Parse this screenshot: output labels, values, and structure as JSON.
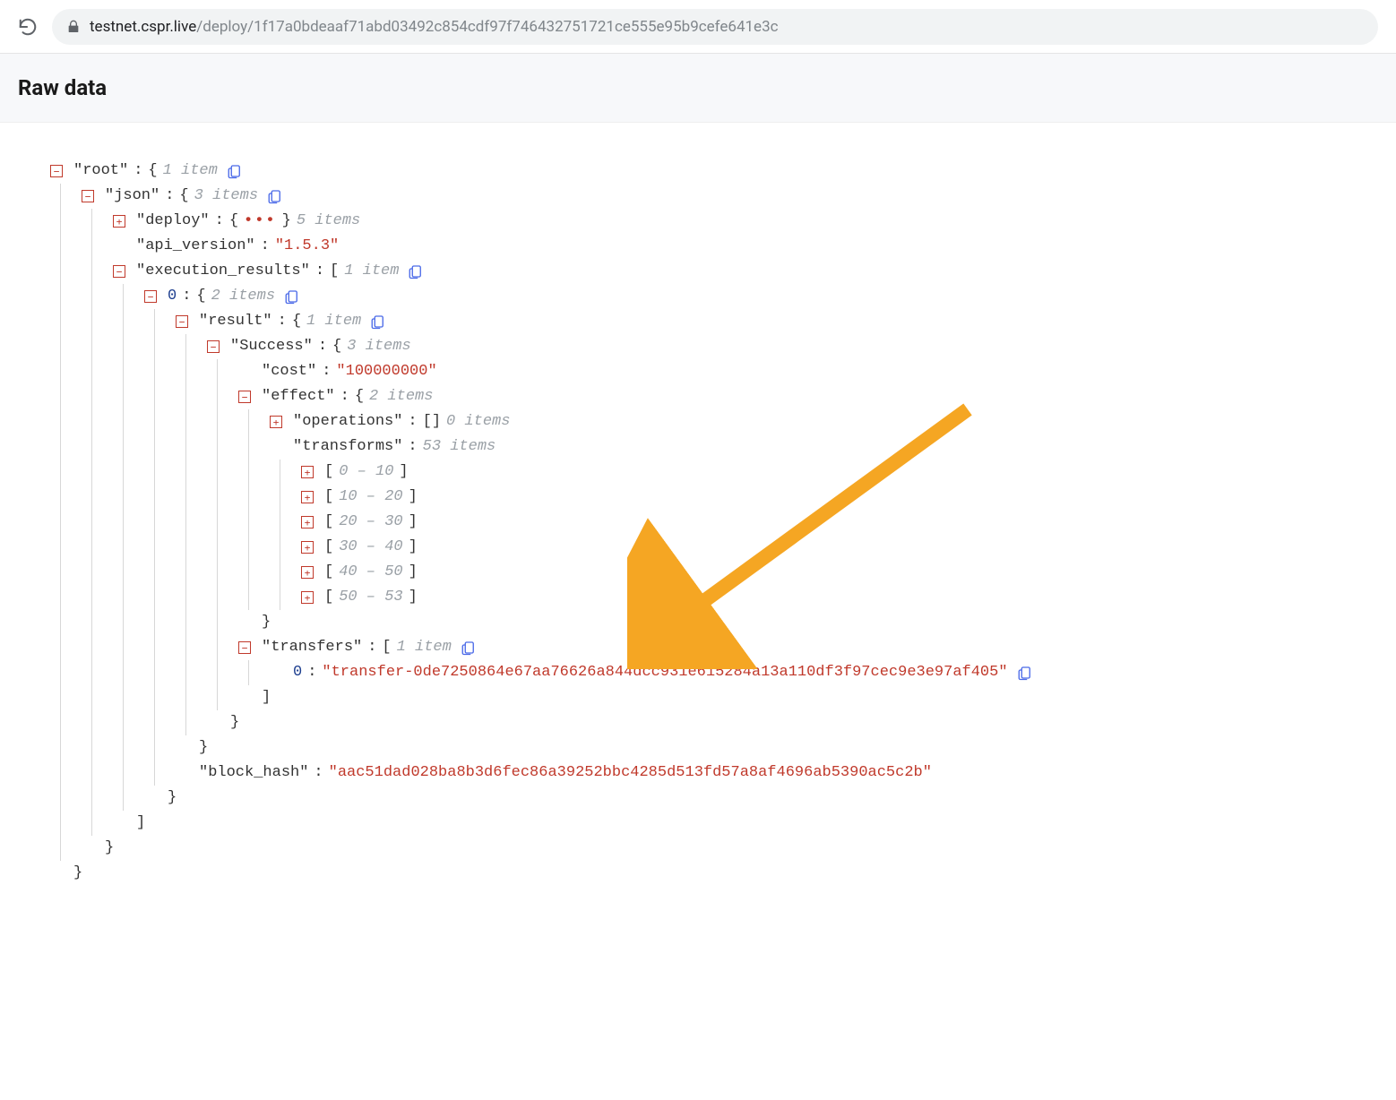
{
  "browser": {
    "url_domain": "testnet.cspr.live",
    "url_path": "/deploy/1f17a0bdeaaf71abd03492c854cdf97f746432751721ce555e95b9cefe641e3c"
  },
  "header": {
    "title": "Raw data"
  },
  "tree": {
    "root_key": "\"root\"",
    "root_meta": "1 item",
    "json_key": "\"json\"",
    "json_meta": "3 items",
    "deploy_key": "\"deploy\"",
    "deploy_meta": "5 items",
    "api_version_key": "\"api_version\"",
    "api_version_val": "\"1.5.3\"",
    "exec_key": "\"execution_results\"",
    "exec_meta": "1 item",
    "idx0": "0",
    "idx0_meta": "2 items",
    "result_key": "\"result\"",
    "result_meta": "1 item",
    "success_key": "\"Success\"",
    "success_meta": "3 items",
    "cost_key": "\"cost\"",
    "cost_val": "\"100000000\"",
    "effect_key": "\"effect\"",
    "effect_meta": "2 items",
    "operations_key": "\"operations\"",
    "operations_meta": "0 items",
    "transforms_key": "\"transforms\"",
    "transforms_meta": "53 items",
    "range_1": "0 – 10",
    "range_2": "10 – 20",
    "range_3": "20 – 30",
    "range_4": "30 – 40",
    "range_5": "40 – 50",
    "range_6": "50 – 53",
    "transfers_key": "\"transfers\"",
    "transfers_meta": "1 item",
    "transfer_idx": "0",
    "transfer_val": "\"transfer-0de7250864e67aa76626a844dcc931e615284a13a110df3f97cec9e3e97af405\"",
    "block_hash_key": "\"block_hash\"",
    "block_hash_val": "\"aac51dad028ba8b3d6fec86a39252bbc4285d513fd57a8af4696ab5390ac5c2b\""
  }
}
